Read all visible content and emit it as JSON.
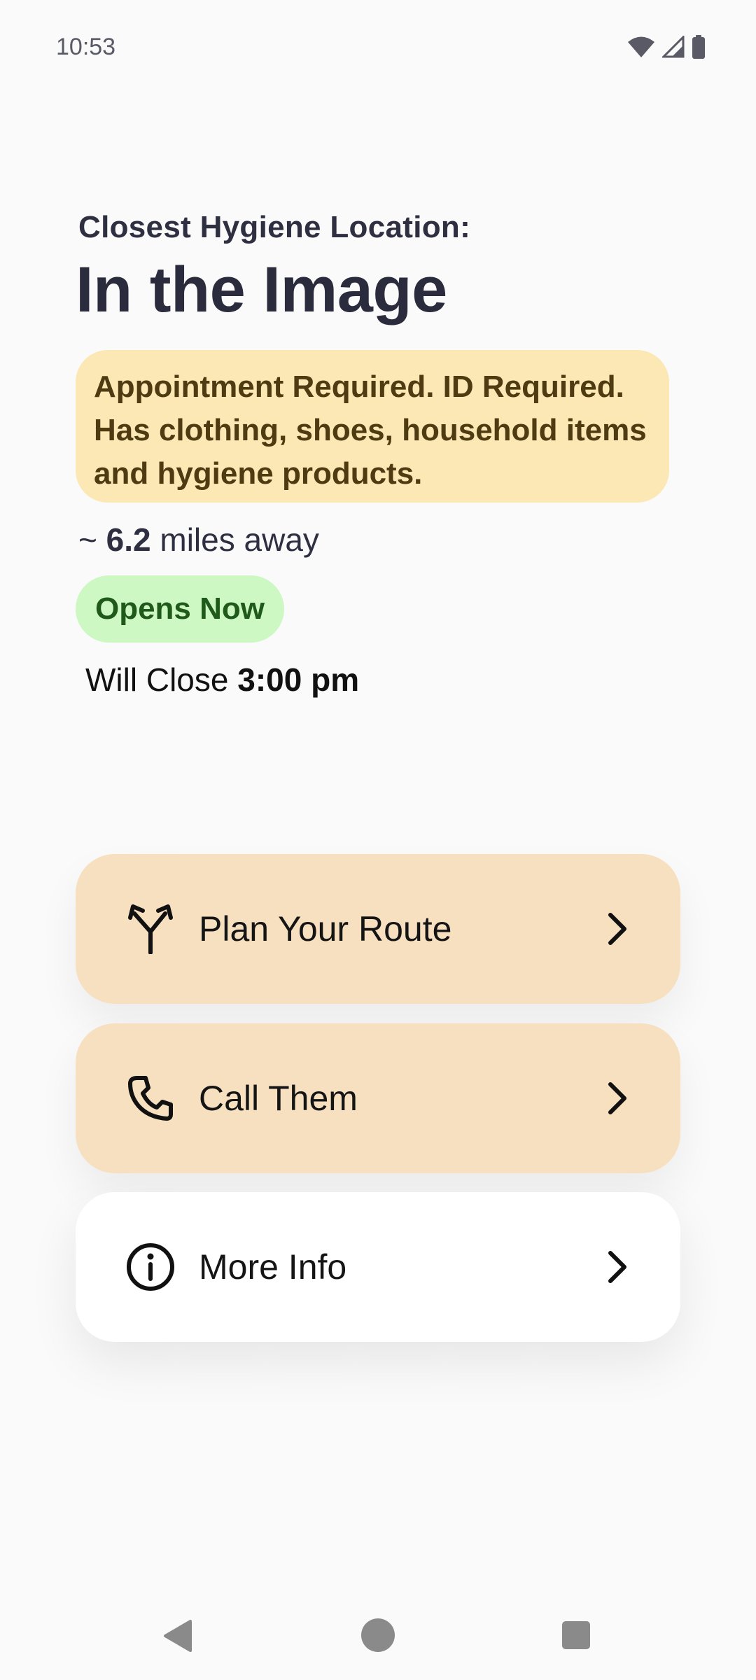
{
  "status_bar": {
    "time": "10:53",
    "icons": [
      "wifi-icon",
      "cell-signal-icon",
      "battery-icon"
    ]
  },
  "header": {
    "subtitle": "Closest Hygiene Location:",
    "title": "In the Image"
  },
  "notice": {
    "text": "Appointment Required. ID Required. Has clothing, shoes, household items and hygiene products."
  },
  "distance": {
    "prefix": "~",
    "value": "6.2",
    "suffix": "miles away"
  },
  "open_status": {
    "label": "Opens Now",
    "color": "#cdf7c3"
  },
  "closing": {
    "prefix": "Will Close",
    "time": "3:00 pm"
  },
  "actions": [
    {
      "label": "Plan Your Route",
      "icon": "route-fork-icon"
    },
    {
      "label": "Call Them",
      "icon": "phone-icon"
    },
    {
      "label": "More Info",
      "icon": "info-circle-icon"
    }
  ],
  "colors": {
    "notice_bg": "#fbe8b5",
    "card_accent": "#f7e0c0",
    "card_plain": "#ffffff",
    "title": "#2b2b3e"
  },
  "nav_bar": {
    "icons": [
      "back-icon",
      "home-icon",
      "recents-icon"
    ]
  }
}
